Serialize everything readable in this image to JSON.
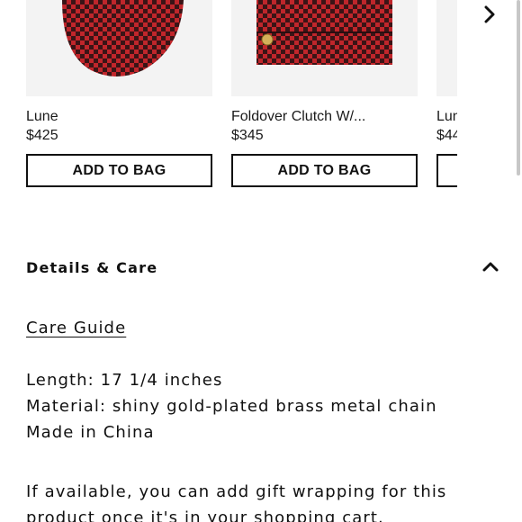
{
  "carousel": {
    "products": [
      {
        "name": "Lune",
        "price": "$425",
        "button": "ADD TO BAG",
        "image_icon": "red-woven-hobo-bag"
      },
      {
        "name": "Foldover Clutch W/...",
        "price": "$345",
        "button": "ADD TO BAG",
        "image_icon": "red-woven-foldover-clutch"
      },
      {
        "name": "Lun",
        "price": "$44",
        "button": "",
        "image_icon": "product-image"
      }
    ],
    "next_icon": "chevron-right-icon"
  },
  "details": {
    "title": "Details & Care",
    "toggle_icon": "chevron-up-icon",
    "care_link": "Care Guide",
    "specs": [
      "Length: 17 1/4 inches",
      "Material: shiny gold-plated brass metal chain",
      "Made in China"
    ],
    "gift_text": "If available, you can add gift wrapping for this product once it's in your shopping cart."
  },
  "colors": {
    "bag_red": "#c0262b",
    "bag_dark": "#3a1416",
    "image_bg": "#f3f3f3"
  }
}
